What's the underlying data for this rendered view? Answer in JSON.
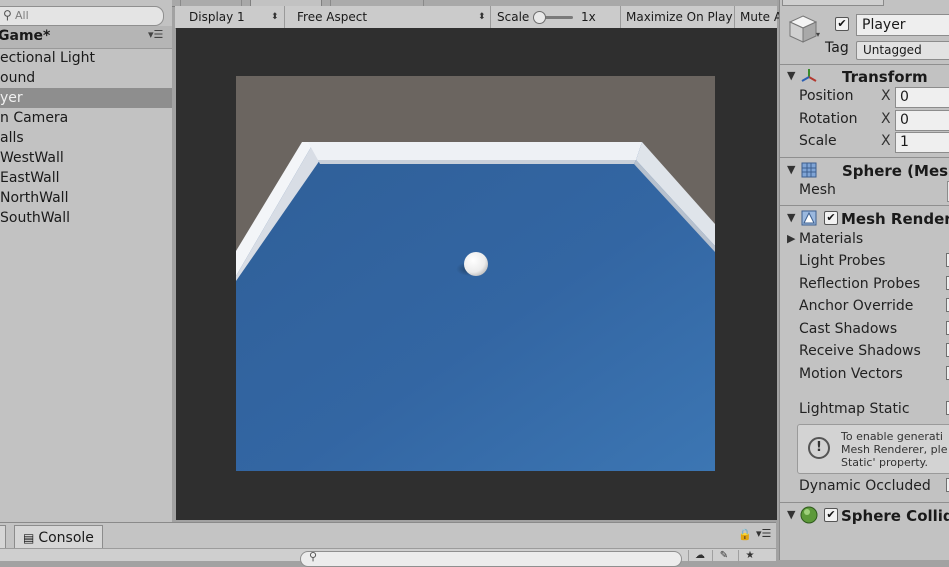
{
  "hierarchy": {
    "search": {
      "placeholder": "All"
    },
    "scene_name": "Game*",
    "items": [
      {
        "label": "ectional Light"
      },
      {
        "label": "ound"
      },
      {
        "label": "yer",
        "selected": true
      },
      {
        "label": "n Camera"
      },
      {
        "label": "alls"
      },
      {
        "label": "WestWall"
      },
      {
        "label": "EastWall"
      },
      {
        "label": "NorthWall"
      },
      {
        "label": "SouthWall"
      }
    ]
  },
  "game_view": {
    "display": "Display 1",
    "aspect": "Free Aspect",
    "scale_label": "Scale",
    "scale_value": "1x",
    "maximize_on_play": "Maximize On Play",
    "mute": "Mute A",
    "scene_colors": {
      "sky": "#6b6560",
      "ground": "#3b6ea8",
      "walls": "#eef1f5",
      "ball": "#ffffff"
    }
  },
  "inspector": {
    "object_name": "Player",
    "tag_label": "Tag",
    "tag_value": "Untagged",
    "transform": {
      "title": "Transform",
      "position_label": "Position",
      "rotation_label": "Rotation",
      "scale_label": "Scale",
      "axis_x": "X",
      "position_x": "0",
      "rotation_x": "0",
      "scale_x": "1"
    },
    "mesh_filter": {
      "title": "Sphere (Mesh",
      "mesh_label": "Mesh"
    },
    "mesh_renderer": {
      "title": "Mesh Renderer",
      "materials": "Materials",
      "light_probes": "Light Probes",
      "reflection_probes": "Reflection Probes",
      "anchor_override": "Anchor Override",
      "cast_shadows": "Cast Shadows",
      "receive_shadows": "Receive Shadows",
      "motion_vectors": "Motion Vectors",
      "lightmap_static": "Lightmap Static",
      "info_line1": "To enable generati",
      "info_line2": "Mesh Renderer, ple",
      "info_line3": "Static' property.",
      "dynamic_occluded": "Dynamic Occluded"
    },
    "sphere_collider": {
      "title": "Sphere Collide"
    }
  },
  "console": {
    "tab_label": "Console"
  }
}
